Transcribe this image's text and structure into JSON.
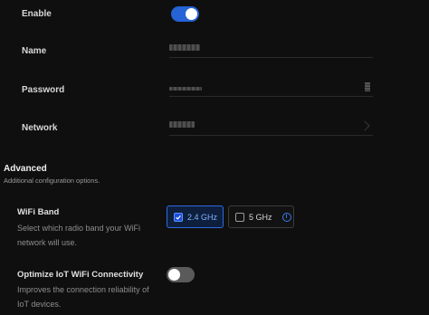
{
  "fields": {
    "enable_label": "Enable",
    "enable_on": true,
    "name_label": "Name",
    "password_label": "Password",
    "network_label": "Network"
  },
  "advanced": {
    "title": "Advanced",
    "subtitle": "Additional configuration options."
  },
  "wifi_band": {
    "title": "WiFi Band",
    "description": "Select which radio band your WiFi network will use.",
    "options": [
      {
        "label": "2.4 GHz",
        "checked": true
      },
      {
        "label": "5 GHz",
        "checked": false
      }
    ],
    "info_icon": "info-icon"
  },
  "iot": {
    "title": "Optimize IoT WiFi Connectivity",
    "description": "Improves the connection reliability of IoT devices.",
    "enabled": false
  },
  "colors": {
    "accent": "#2563d6",
    "background": "#0f0f0f"
  }
}
